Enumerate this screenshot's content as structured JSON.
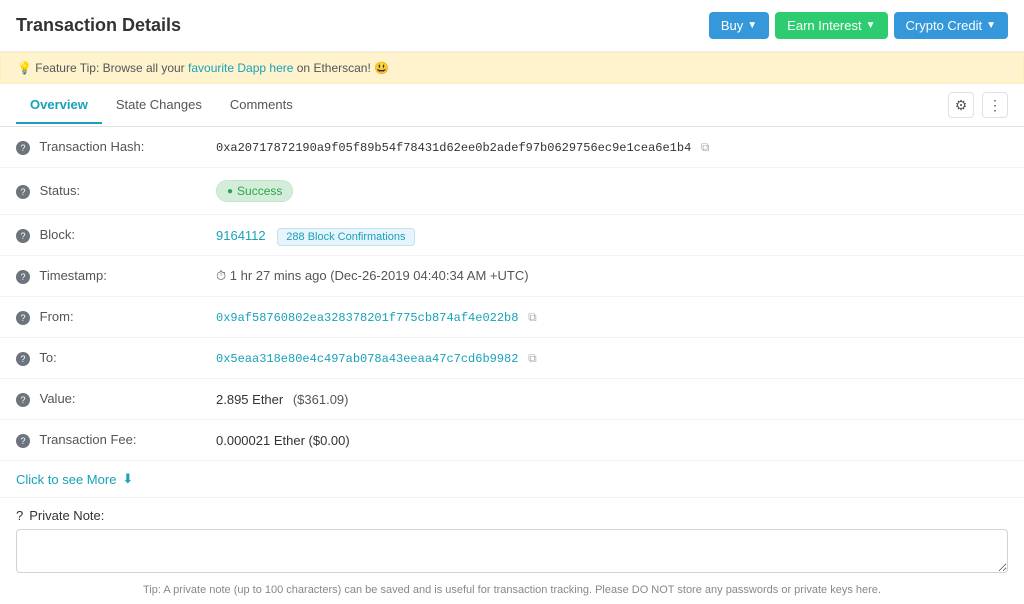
{
  "header": {
    "title": "Transaction Details",
    "buttons": {
      "buy": "Buy",
      "earn": "Earn Interest",
      "crypto": "Crypto Credit"
    }
  },
  "feature_tip": {
    "prefix": "Feature Tip: Browse all your ",
    "link_text": "favourite Dapp here",
    "suffix": " on Etherscan! 😃"
  },
  "tabs": {
    "overview": "Overview",
    "state_changes": "State Changes",
    "comments": "Comments"
  },
  "fields": {
    "tx_hash_label": "Transaction Hash:",
    "tx_hash_value": "0xa20717872190a9f05f89b54f78431d62ee0b2adef97b0629756ec9e1cea6e1b4",
    "status_label": "Status:",
    "status_value": "Success",
    "block_label": "Block:",
    "block_number": "9164112",
    "block_confirmations": "288 Block Confirmations",
    "timestamp_label": "Timestamp:",
    "timestamp_value": "⏱ 1 hr 27 mins ago (Dec-26-2019 04:40:34 AM +UTC)",
    "from_label": "From:",
    "from_value": "0x9af58760802ea328378201f775cb874af4e022b8",
    "to_label": "To:",
    "to_value": "0x5eaa318e80e4c497ab078a43eeaa47c7cd6b9982",
    "value_label": "Value:",
    "value_ether": "2.895 Ether",
    "value_usd": "($361.09)",
    "fee_label": "Transaction Fee:",
    "fee_value": "0.000021 Ether ($0.00)"
  },
  "click_more": "Click to see More",
  "private_note": {
    "label": "Private Note:",
    "placeholder": "",
    "tip": "Tip: A private note (up to 100 characters) can be saved and is useful for transaction tracking. Please DO NOT store any passwords or private keys here."
  }
}
